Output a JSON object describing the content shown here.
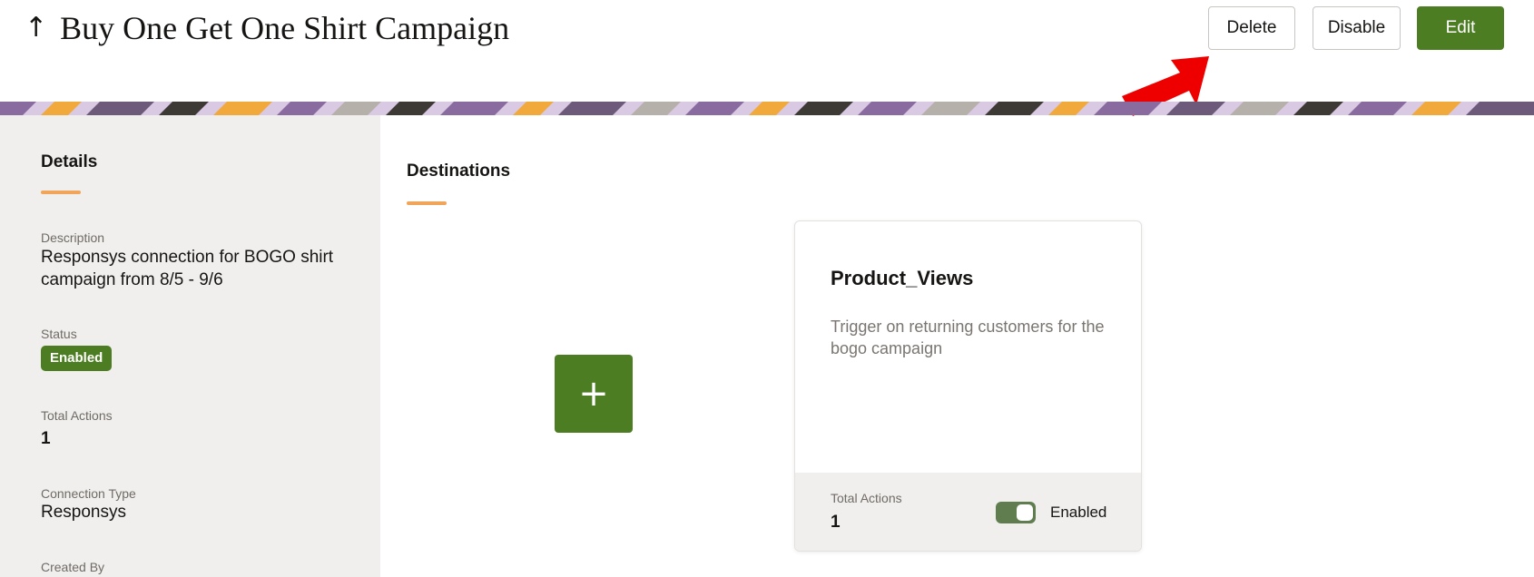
{
  "header": {
    "back_icon": "up-arrow-icon",
    "title": "Buy One Get One Shirt Campaign",
    "buttons": {
      "delete_label": "Delete",
      "disable_label": "Disable",
      "edit_label": "Edit"
    }
  },
  "colors": {
    "primary_green": "#4d7d22",
    "accent_orange": "#f0a55a",
    "annotation_red": "#ee0000",
    "panel_bg": "#f1efed"
  },
  "details": {
    "section_title": "Details",
    "description_label": "Description",
    "description_value": "Responsys connection for BOGO shirt campaign from 8/5 - 9/6",
    "status_label": "Status",
    "status_value": "Enabled",
    "total_actions_label": "Total Actions",
    "total_actions_value": "1",
    "connection_type_label": "Connection Type",
    "connection_type_value": "Responsys",
    "created_by_label": "Created By"
  },
  "destinations": {
    "section_title": "Destinations",
    "add_label": "+",
    "cards": [
      {
        "title": "Product_Views",
        "description": "Trigger on returning customers for the bogo campaign",
        "total_actions_label": "Total Actions",
        "total_actions_value": "1",
        "toggle_label": "Enabled",
        "enabled": true
      }
    ]
  }
}
